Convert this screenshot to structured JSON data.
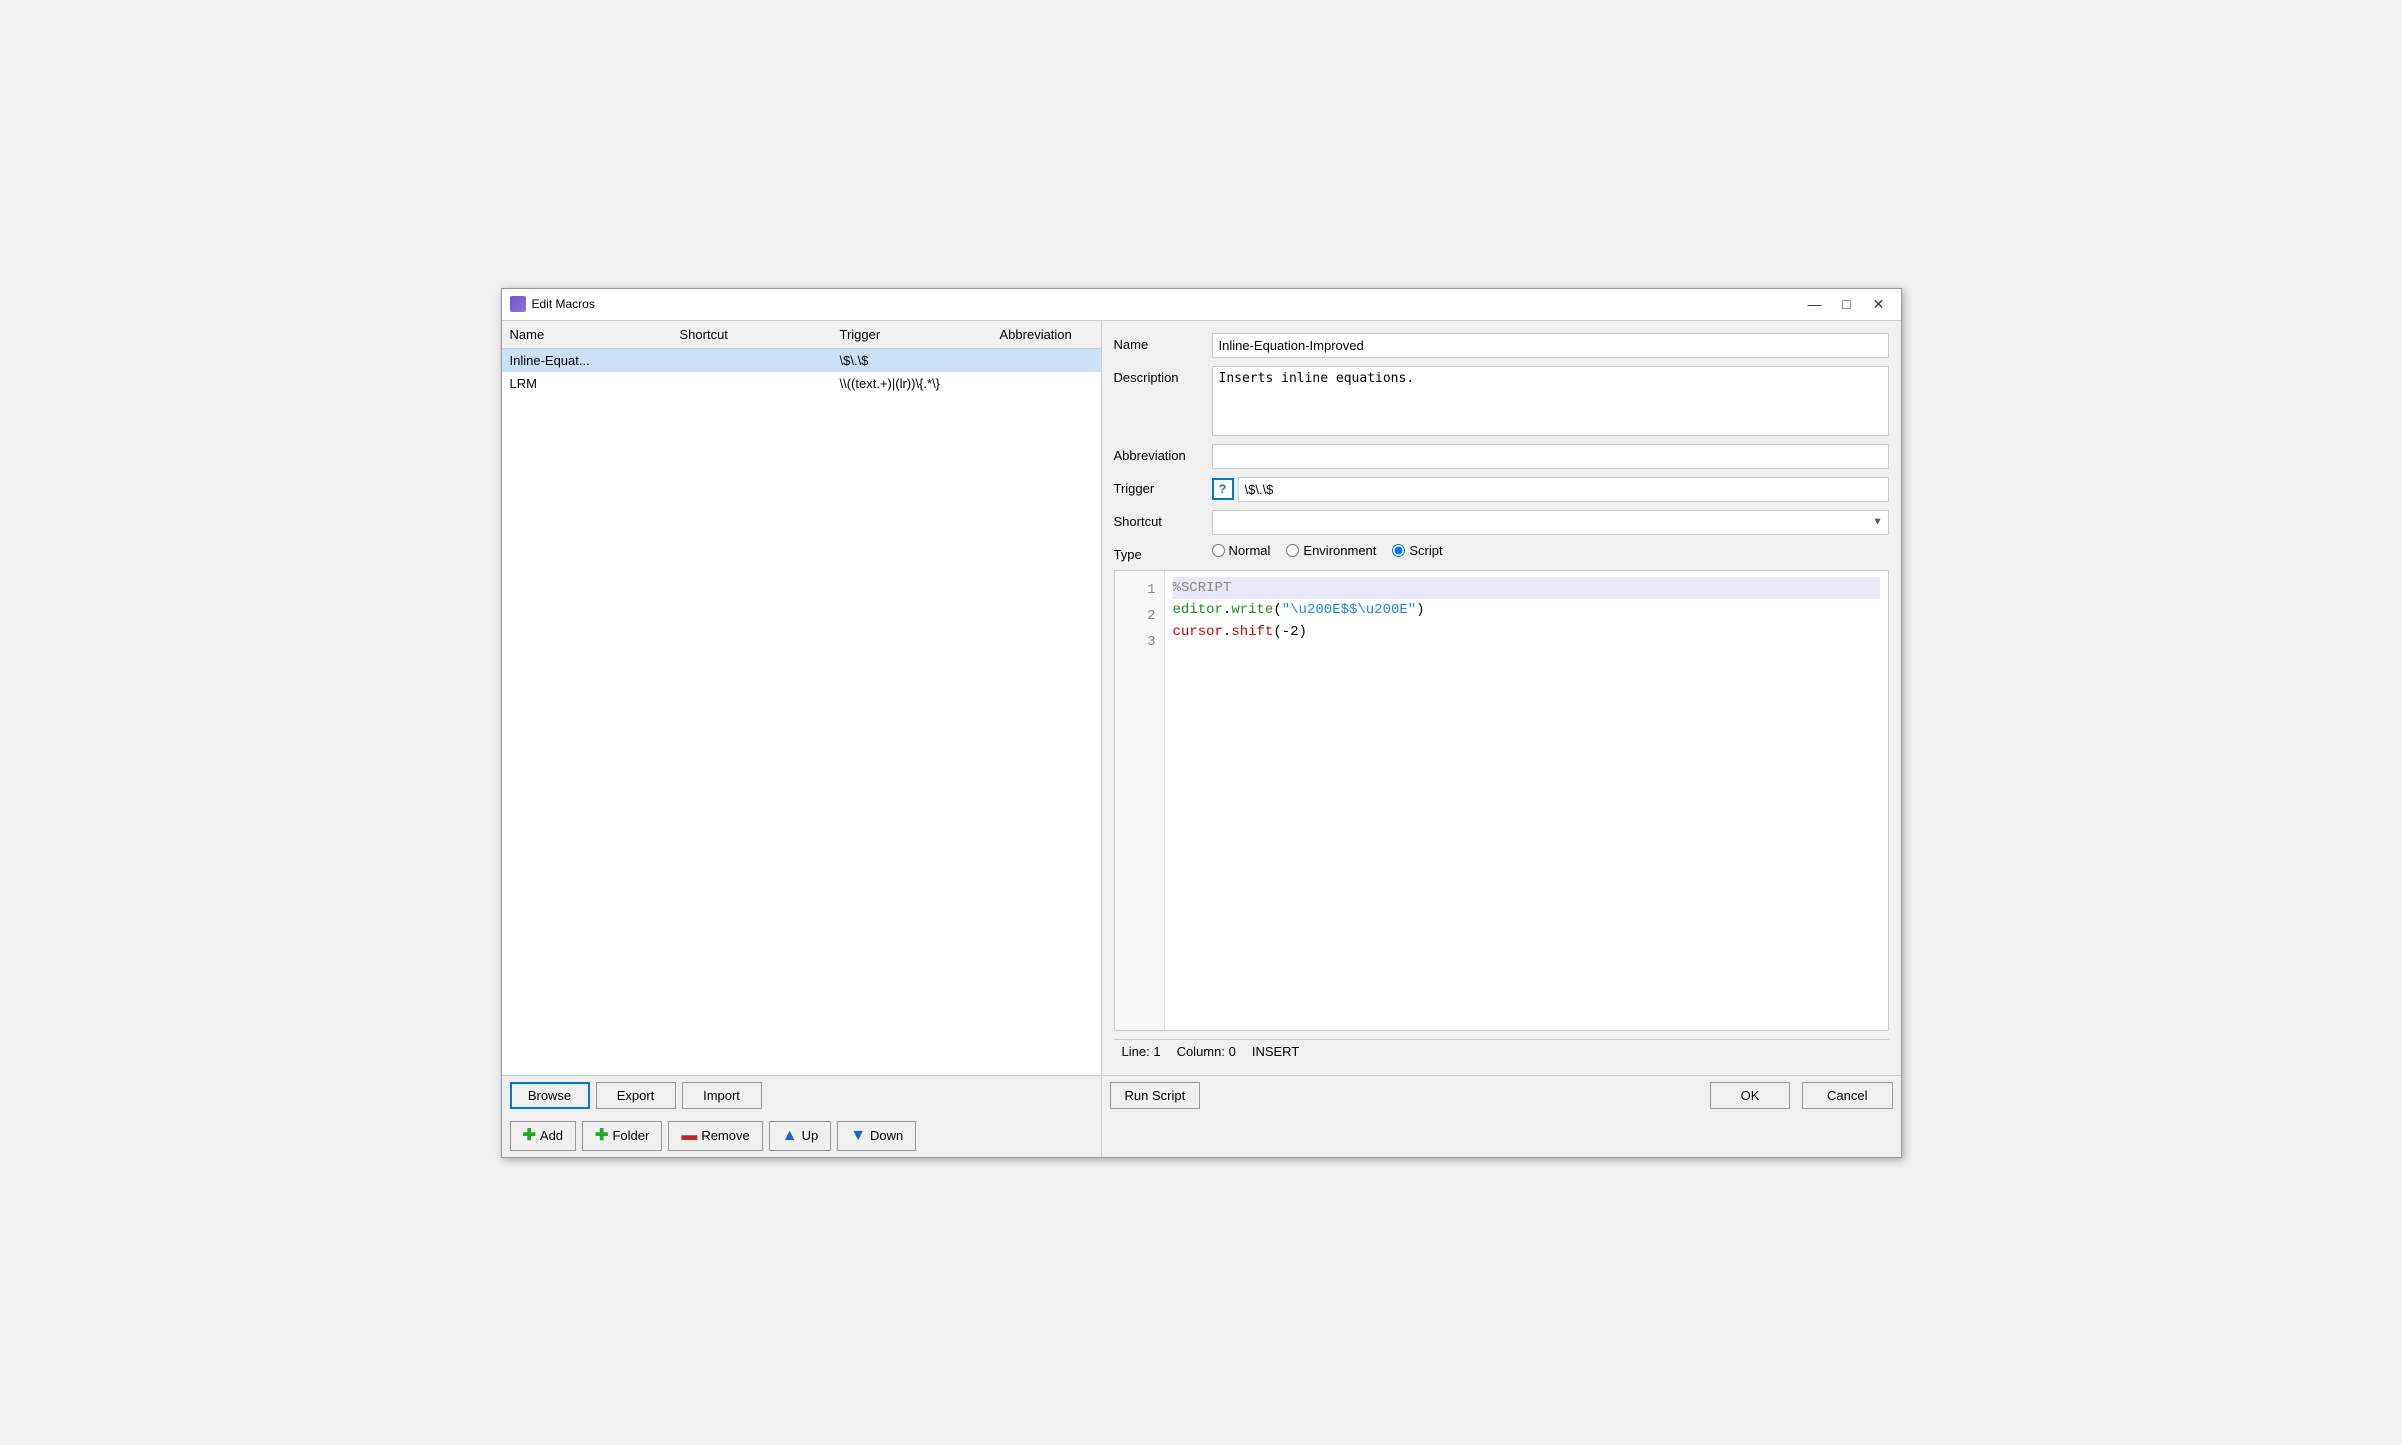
{
  "window": {
    "title": "Edit Macros",
    "icon": "macro-icon"
  },
  "list": {
    "headers": [
      "Name",
      "Shortcut",
      "Trigger",
      "Abbreviation"
    ],
    "rows": [
      {
        "name": "Inline-Equat...",
        "shortcut": "",
        "trigger": "\\$\\.\\$",
        "abbreviation": ""
      },
      {
        "name": "LRM",
        "shortcut": "",
        "trigger": "\\\\((text.+)|(lr))\\{.*\\}",
        "abbreviation": ""
      }
    ],
    "selected_index": 0
  },
  "left_footer": {
    "browse_label": "Browse",
    "export_label": "Export",
    "import_label": "Import"
  },
  "form": {
    "name_label": "Name",
    "name_value": "Inline-Equation-Improved",
    "description_label": "Description",
    "description_value": "Inserts inline equations.",
    "abbreviation_label": "Abbreviation",
    "abbreviation_value": "",
    "trigger_label": "Trigger",
    "trigger_help": "?",
    "trigger_value": "\\$\\.\\$",
    "shortcut_label": "Shortcut",
    "shortcut_value": "",
    "type_label": "Type",
    "types": [
      "Normal",
      "Environment",
      "Script"
    ],
    "selected_type": "Script"
  },
  "code_editor": {
    "lines": [
      {
        "number": 1,
        "content": "%SCRIPT",
        "type": "comment",
        "highlighted": true
      },
      {
        "number": 2,
        "content": "editor.write(\"\\u200E$$\\u200E\")",
        "type": "code"
      },
      {
        "number": 3,
        "content": "cursor.shift(-2)",
        "type": "code"
      }
    ]
  },
  "status_bar": {
    "line_label": "Line:",
    "line_value": "1",
    "column_label": "Column:",
    "column_value": "0",
    "mode": "INSERT"
  },
  "bottom_buttons": {
    "add_label": "Add",
    "folder_label": "Folder",
    "remove_label": "Remove",
    "up_label": "Up",
    "down_label": "Down",
    "run_script_label": "Run Script",
    "ok_label": "OK",
    "cancel_label": "Cancel"
  },
  "colors": {
    "accent": "#0078d7",
    "selected_row": "#cce0f7",
    "code_highlight": "#e8e8f8",
    "comment_color": "#888888",
    "method_color": "#228B22",
    "string_color": "#1e88e5",
    "keyword_color": "#CC0000"
  }
}
